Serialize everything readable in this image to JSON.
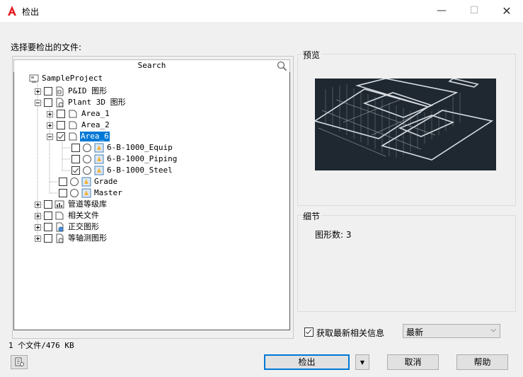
{
  "window": {
    "title": "检出",
    "app_icon": "autocad-a-icon"
  },
  "controls": {
    "minimize": "—",
    "maximize": "☐",
    "close": "✕"
  },
  "prompt": "选择要检出的文件:",
  "search": {
    "label": "Search"
  },
  "tree": {
    "root": "SampleProject",
    "pid": "P&ID 图形",
    "plant3d": "Plant 3D 图形",
    "area1": "Area_1",
    "area2": "Area_2",
    "area6": "Area_6",
    "equip": "6-B-1000_Equip",
    "piping": "6-B-1000_Piping",
    "steel": "6-B-1000_Steel",
    "grade": "Grade",
    "master": "Master",
    "spec": "管道等级库",
    "related": "相关文件",
    "ortho": "正交图形",
    "iso": "等轴测图形"
  },
  "status": "1 个文件/476 KB",
  "preview": {
    "label": "预览"
  },
  "details": {
    "label": "细节",
    "count_text": "图形数: 3"
  },
  "get_latest": {
    "label": "获取最新相关信息",
    "checked": true
  },
  "version_select": {
    "value": "最新"
  },
  "buttons": {
    "checkout": "检出",
    "cancel": "取消",
    "help": "帮助"
  }
}
